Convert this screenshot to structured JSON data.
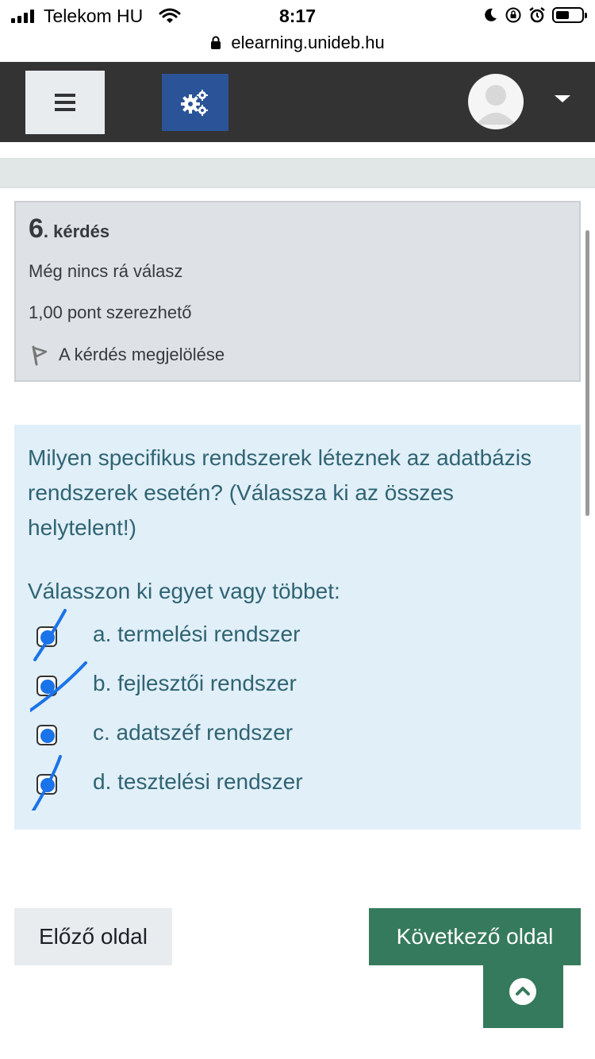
{
  "status": {
    "carrier": "Telekom HU",
    "time": "8:17",
    "url": "elearning.unideb.hu"
  },
  "navbar": {
    "menu_icon": "hamburger-icon",
    "gear_icon": "cogs-icon",
    "avatar_icon": "user-avatar",
    "dropdown_icon": "caret-down-icon"
  },
  "question_info": {
    "number": "6",
    "number_suffix": ". kérdés",
    "state": "Még nincs rá válasz",
    "grade": "1,00 pont szerezhető",
    "flag_label": "A kérdés megjelölése"
  },
  "question": {
    "text": "Milyen specifikus rendszerek léteznek az adatbázis rendszerek esetén? (Válassza ki az összes helytelent!)",
    "prompt": "Válasszon ki egyet vagy többet:",
    "options": [
      {
        "label": "a. termelési rendszer",
        "checked": true,
        "struck": true
      },
      {
        "label": "b. fejlesztői rendszer",
        "checked": true,
        "struck": true
      },
      {
        "label": "c. adatszéf rendszer",
        "checked": true,
        "struck": false
      },
      {
        "label": "d. tesztelési rendszer",
        "checked": true,
        "struck": true
      }
    ],
    "mark_color": "#1a73e8"
  },
  "navigation": {
    "prev_label": "Előző oldal",
    "next_label": "Következő oldal",
    "top_icon": "chevron-up-icon"
  },
  "colors": {
    "navbar": "#333333",
    "gear_button": "#2b5397",
    "primary": "#357a5c",
    "info_card": "#dee2e6",
    "question_bg": "#e1eff8",
    "question_text": "#2f6473"
  }
}
